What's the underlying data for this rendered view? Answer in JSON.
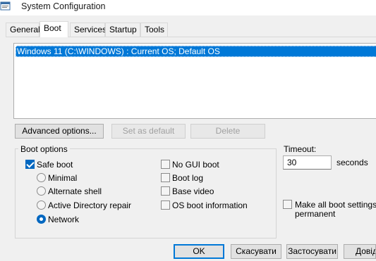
{
  "window": {
    "title": "System Configuration",
    "icon": "msconfig-app-icon"
  },
  "tabs": [
    {
      "label": "General",
      "active": false
    },
    {
      "label": "Boot",
      "active": true
    },
    {
      "label": "Services",
      "active": false
    },
    {
      "label": "Startup",
      "active": false
    },
    {
      "label": "Tools",
      "active": false
    }
  ],
  "os_list": {
    "items": [
      "Windows 11 (C:\\WINDOWS) : Current OS; Default OS"
    ],
    "selected": 0
  },
  "os_buttons": {
    "advanced": "Advanced options...",
    "set_default": "Set as default",
    "delete": "Delete"
  },
  "boot_options": {
    "title": "Boot options",
    "safe_boot": {
      "label": "Safe boot",
      "checked": true
    },
    "modes": [
      {
        "label": "Minimal",
        "checked": false
      },
      {
        "label": "Alternate shell",
        "checked": false
      },
      {
        "label": "Active Directory repair",
        "checked": false
      },
      {
        "label": "Network",
        "checked": true
      }
    ],
    "no_gui_boot": {
      "label": "No GUI boot",
      "checked": false
    },
    "boot_log": {
      "label": "Boot log",
      "checked": false
    },
    "base_video": {
      "label": "Base video",
      "checked": false
    },
    "os_boot_info": {
      "label": "OS boot information",
      "checked": false
    }
  },
  "timeout": {
    "label": "Timeout:",
    "value": "30",
    "unit": "seconds"
  },
  "permanent": {
    "label_line1": "Make all boot settings",
    "label_line2": "permanent",
    "checked": false
  },
  "dialog_buttons": {
    "ok": "OK",
    "cancel": "Скасувати",
    "apply": "Застосувати",
    "help": "Довідка"
  },
  "colors": {
    "selection": "#0078d7",
    "checkbox_checked": "#0067c0",
    "background": "#f0f0f0"
  }
}
